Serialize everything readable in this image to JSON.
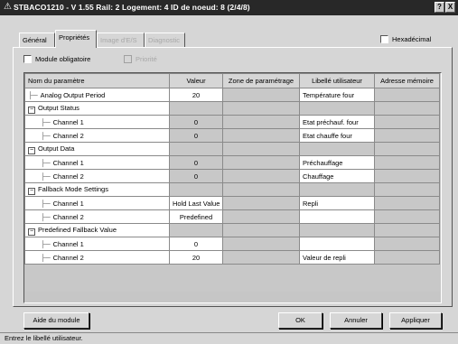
{
  "window": {
    "title": "STBACO1210 - V 1.55 Rail: 2 Logement: 4 ID de noeud: 8 (2/4/8)",
    "help_btn": "?",
    "close_btn": "X"
  },
  "tabs": [
    {
      "label": "Général",
      "state": "normal"
    },
    {
      "label": "Propriétés",
      "state": "active"
    },
    {
      "label": "Image d'E/S",
      "state": "disabled"
    },
    {
      "label": "Diagnostic",
      "state": "disabled"
    }
  ],
  "options": {
    "hexadecimal": "Hexadécimal",
    "module_obligatoire": "Module obligatoire",
    "priorite": "Priorité"
  },
  "table": {
    "headers": [
      "Nom du paramètre",
      "Valeur",
      "Zone de paramétrage",
      "Libellé utilisateur",
      "Adresse mémoire"
    ],
    "rows": [
      {
        "name": "Analog Output Period",
        "kind": "leaf",
        "level": 0,
        "value": "20",
        "libelle": "Température four"
      },
      {
        "name": "Output Status",
        "kind": "group",
        "level": 0,
        "value": "",
        "libelle": ""
      },
      {
        "name": "Channel 1",
        "kind": "leaf",
        "level": 1,
        "value": "0",
        "libelle": "Etat préchauf. four",
        "shaded": true
      },
      {
        "name": "Channel 2",
        "kind": "leaf",
        "level": 1,
        "value": "0",
        "libelle": "Etat chauffe four",
        "shaded": true
      },
      {
        "name": "Output Data",
        "kind": "group",
        "level": 0,
        "value": "",
        "libelle": ""
      },
      {
        "name": "Channel 1",
        "kind": "leaf",
        "level": 1,
        "value": "0",
        "libelle": "Préchauffage",
        "shaded": true
      },
      {
        "name": "Channel 2",
        "kind": "leaf",
        "level": 1,
        "value": "0",
        "libelle": "Chauffage",
        "shaded": true
      },
      {
        "name": "Fallback Mode Settings",
        "kind": "group",
        "level": 0,
        "value": "",
        "libelle": ""
      },
      {
        "name": "Channel 1",
        "kind": "leaf",
        "level": 1,
        "value": "Hold Last Value",
        "libelle": "Repli"
      },
      {
        "name": "Channel 2",
        "kind": "leaf",
        "level": 1,
        "value": "Predefined",
        "libelle": ""
      },
      {
        "name": "Predefined Fallback Value",
        "kind": "group",
        "level": 0,
        "value": "",
        "libelle": ""
      },
      {
        "name": "Channel 1",
        "kind": "leaf",
        "level": 1,
        "value": "0",
        "libelle": ""
      },
      {
        "name": "Channel 2",
        "kind": "leaf",
        "level": 1,
        "value": "20",
        "libelle": "Valeur de repli"
      }
    ]
  },
  "buttons": {
    "aide": "Aide du module",
    "ok": "OK",
    "annuler": "Annuler",
    "appliquer": "Appliquer"
  },
  "status": "Entrez le libellé utilisateur."
}
